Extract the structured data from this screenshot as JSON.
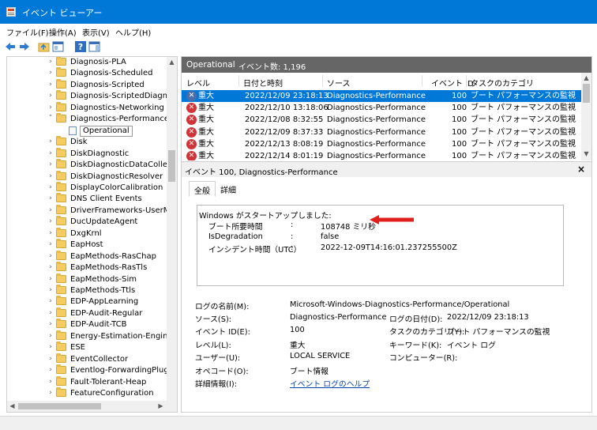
{
  "window": {
    "title": "イベント ビューアー"
  },
  "menu": [
    {
      "label": "ファイル(F)"
    },
    {
      "label": "操作(A)"
    },
    {
      "label": "表示(V)"
    },
    {
      "label": "ヘルプ(H)"
    }
  ],
  "toolbar": {
    "back_icon": "back-arrow-icon",
    "forward_icon": "forward-arrow-icon",
    "up_icon": "up-folder-icon",
    "console_icon": "console-tree-icon",
    "help_icon": "help-icon",
    "panel_icon": "action-pane-icon"
  },
  "tree": {
    "items": [
      {
        "label": "Diagnosis-PLA",
        "expanded": false
      },
      {
        "label": "Diagnosis-Scheduled",
        "expanded": false
      },
      {
        "label": "Diagnosis-Scripted",
        "expanded": false
      },
      {
        "label": "Diagnosis-ScriptedDiagnostics",
        "expanded": false
      },
      {
        "label": "Diagnostics-Networking",
        "expanded": false
      },
      {
        "label": "Diagnostics-Performance",
        "expanded": true
      },
      {
        "label": "Operational",
        "child": true,
        "selected": true
      },
      {
        "label": "Disk",
        "expanded": false
      },
      {
        "label": "DiskDiagnostic",
        "expanded": false
      },
      {
        "label": "DiskDiagnosticDataCollector",
        "expanded": false
      },
      {
        "label": "DiskDiagnosticResolver",
        "expanded": false
      },
      {
        "label": "DisplayColorCalibration",
        "expanded": false
      },
      {
        "label": "DNS Client Events",
        "expanded": false
      },
      {
        "label": "DriverFrameworks-UserMode",
        "expanded": false
      },
      {
        "label": "DucUpdateAgent",
        "expanded": false
      },
      {
        "label": "DxgKrnl",
        "expanded": false
      },
      {
        "label": "EapHost",
        "expanded": false
      },
      {
        "label": "EapMethods-RasChap",
        "expanded": false
      },
      {
        "label": "EapMethods-RasTls",
        "expanded": false
      },
      {
        "label": "EapMethods-Sim",
        "expanded": false
      },
      {
        "label": "EapMethods-Ttls",
        "expanded": false
      },
      {
        "label": "EDP-AppLearning",
        "expanded": false
      },
      {
        "label": "EDP-Audit-Regular",
        "expanded": false
      },
      {
        "label": "EDP-Audit-TCB",
        "expanded": false
      },
      {
        "label": "Energy-Estimation-Engine",
        "expanded": false
      },
      {
        "label": "ESE",
        "expanded": false
      },
      {
        "label": "EventCollector",
        "expanded": false
      },
      {
        "label": "Eventlog-ForwardingPlugin",
        "expanded": false
      },
      {
        "label": "Fault-Tolerant-Heap",
        "expanded": false
      },
      {
        "label": "FeatureConfiguration",
        "expanded": false
      }
    ]
  },
  "log": {
    "name": "Operational",
    "count_label": "イベント数: 1,196"
  },
  "grid": {
    "columns": [
      "レベル",
      "日付と時刻",
      "ソース",
      "イベント ID",
      "タスクのカテゴリ"
    ],
    "rows": [
      {
        "level": "重大",
        "datetime": "2022/12/09 23:18:13",
        "source": "Diagnostics-Performance",
        "id": "100",
        "category": "ブート パフォーマンスの監視",
        "selected": true
      },
      {
        "level": "重大",
        "datetime": "2022/12/10 13:18:06",
        "source": "Diagnostics-Performance",
        "id": "100",
        "category": "ブート パフォーマンスの監視"
      },
      {
        "level": "重大",
        "datetime": "2022/12/08 8:32:55",
        "source": "Diagnostics-Performance",
        "id": "100",
        "category": "ブート パフォーマンスの監視"
      },
      {
        "level": "重大",
        "datetime": "2022/12/09 8:37:33",
        "source": "Diagnostics-Performance",
        "id": "100",
        "category": "ブート パフォーマンスの監視"
      },
      {
        "level": "重大",
        "datetime": "2022/12/13 8:08:19",
        "source": "Diagnostics-Performance",
        "id": "100",
        "category": "ブート パフォーマンスの監視"
      },
      {
        "level": "重大",
        "datetime": "2022/12/14 8:01:19",
        "source": "Diagnostics-Performance",
        "id": "100",
        "category": "ブート パフォーマンスの監視"
      }
    ]
  },
  "detail": {
    "title": "イベント 100, Diagnostics-Performance",
    "close": "×",
    "tabs": [
      "全般",
      "詳細"
    ],
    "description": {
      "heading": "Windows がスタートアップしました:",
      "lines": [
        {
          "key": "ブート所要時間",
          "sep": ":",
          "value": "108748 ミリ秒"
        },
        {
          "key": "IsDegradation",
          "sep": ":",
          "value": "false"
        },
        {
          "key": "インシデント時間（UTC）",
          "sep": ":",
          "value": "2022-12-09T14:16:01.237255500Z"
        }
      ]
    },
    "props": {
      "log_name_label": "ログの名前(M):",
      "log_name": "Microsoft-Windows-Diagnostics-Performance/Operational",
      "source_label": "ソース(S):",
      "source": "Diagnostics-Performance",
      "logged_label": "ログの日付(D):",
      "logged": "2022/12/09 23:18:13",
      "event_id_label": "イベント ID(E):",
      "event_id": "100",
      "task_label": "タスクのカテゴリ(Y):",
      "task": "ブート パフォーマンスの監視",
      "level_label": "レベル(L):",
      "level": "重大",
      "keywords_label": "キーワード(K):",
      "keywords": "イベント ログ",
      "user_label": "ユーザー(U):",
      "user": "LOCAL SERVICE",
      "computer_label": "コンピューター(R):",
      "computer": "",
      "opcode_label": "オペコード(O):",
      "opcode": "ブート情報",
      "more_label": "詳細情報(I):",
      "more_link": "イベント ログのヘルプ"
    }
  },
  "colors": {
    "titlebar": "#0078d7",
    "selection": "#0078d7",
    "error": "#d13438",
    "arrow": "#e0201c",
    "log_header": "#666666"
  }
}
